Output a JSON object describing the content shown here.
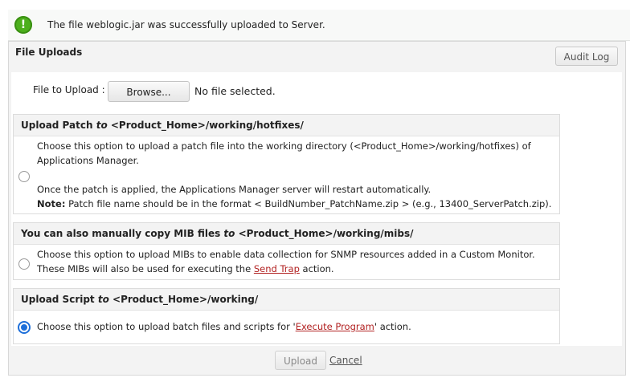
{
  "message": {
    "icon": "success-exclamation-icon",
    "text": "The file weblogic.jar was successfully uploaded to Server."
  },
  "panel": {
    "title": "File Uploads",
    "audit_label": "Audit Log"
  },
  "file": {
    "label": "File to Upload :",
    "browse_label": "Browse...",
    "status": "No file selected."
  },
  "options": {
    "patch": {
      "head_a": "Upload Patch ",
      "head_b": "to",
      "head_c": " <Product_Home>/working/hotfixes/",
      "line1": "Choose this option to upload a patch file into the working directory (<Product_Home>/working/hotfixes) of Applications Manager.",
      "line2": "Once the patch is applied, the Applications Manager server will restart automatically.",
      "note_label": "Note:",
      "note_text": " Patch file name should be in the format < BuildNumber_PatchName.zip > (e.g., 13400_ServerPatch.zip).",
      "selected": false
    },
    "mibs": {
      "head_a": "You can also manually copy MIB files ",
      "head_b": "to",
      "head_c": " <Product_Home>/working/mibs/",
      "text_a": "Choose this option to upload MIBs to enable data collection for SNMP resources added in a Custom Monitor. These MIBs will also be used for executing the ",
      "link": "Send Trap",
      "text_b": " action.",
      "selected": false
    },
    "script": {
      "head_a": "Upload Script ",
      "head_b": "to",
      "head_c": " <Product_Home>/working/",
      "text_a": "Choose this option to upload batch files and scripts for '",
      "link": "Execute Program",
      "text_b": "' action.",
      "selected": true
    }
  },
  "footer": {
    "upload_label": "Upload",
    "cancel_label": "Cancel"
  },
  "colors": {
    "success": "#4caf1c",
    "link": "#b22222",
    "radio_selected": "#1e6fd9"
  }
}
